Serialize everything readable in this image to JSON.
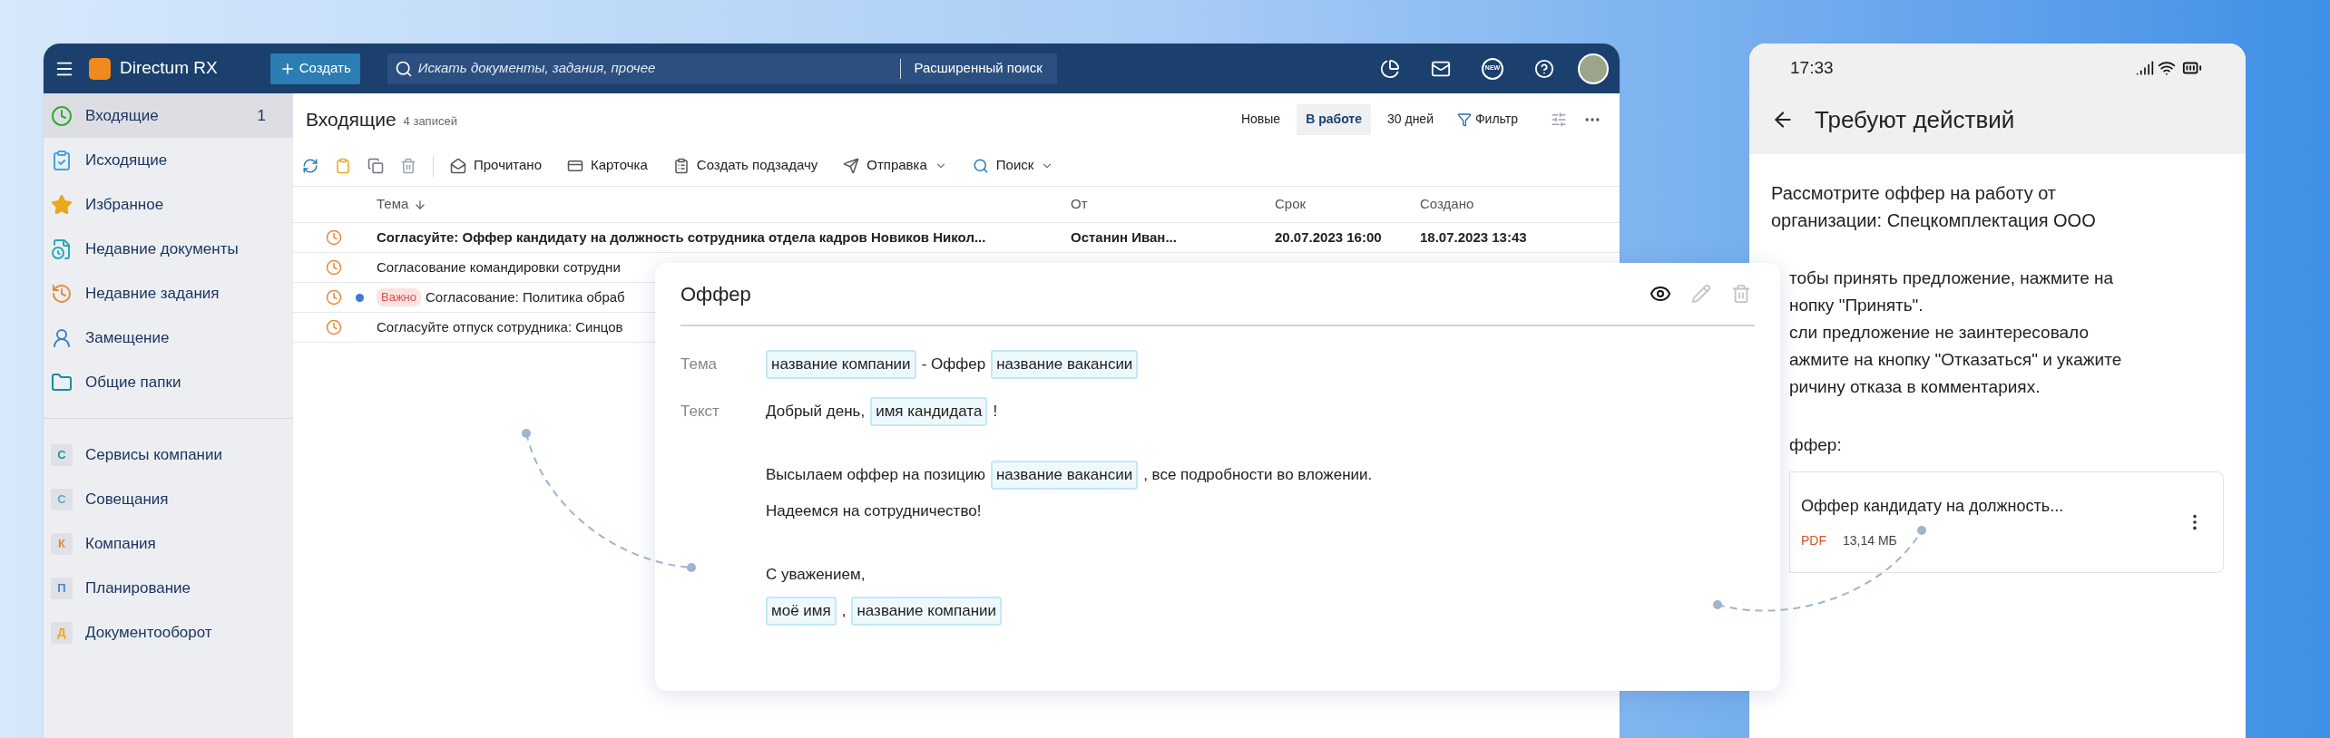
{
  "app": {
    "brand": "Directum RX",
    "create_button": "Создать",
    "search": {
      "placeholder": "Искать документы, задания, прочее"
    },
    "advanced_search": "Расширенный поиск",
    "new_badge": "NEW"
  },
  "sidebar": {
    "items": [
      {
        "kind": "folder",
        "label": "Входящие",
        "count": "1",
        "selected": true
      },
      {
        "kind": "folder",
        "label": "Исходящие",
        "selected": false
      },
      {
        "kind": "folder",
        "label": "Избранное",
        "selected": false
      },
      {
        "kind": "folder",
        "label": "Недавние документы",
        "selected": false
      },
      {
        "kind": "folder",
        "label": "Недавние задания",
        "selected": false
      },
      {
        "kind": "folder",
        "label": "Замещение",
        "selected": false
      },
      {
        "kind": "folder",
        "label": "Общие папки",
        "selected": false
      },
      {
        "kind": "module",
        "letter": "С",
        "color": "#1a9aa0",
        "label": "Сервисы компании",
        "selected": false
      },
      {
        "kind": "module",
        "letter": "С",
        "color": "#5aa9d6",
        "label": "Совещания",
        "selected": false
      },
      {
        "kind": "module",
        "letter": "К",
        "color": "#e08a3c",
        "label": "Компания",
        "selected": false
      },
      {
        "kind": "module",
        "letter": "П",
        "color": "#4a86c8",
        "label": "Планирование",
        "selected": false
      },
      {
        "kind": "module",
        "letter": "Д",
        "color": "#e5a823",
        "label": "Документооборот",
        "selected": false
      }
    ]
  },
  "list": {
    "title": "Входящие",
    "count": "4 записей",
    "filters": [
      {
        "label": "Новые",
        "selected": false
      },
      {
        "label": "В работе",
        "selected": true
      },
      {
        "label": "30 дней",
        "selected": false
      }
    ],
    "filter_button": "Фильтр",
    "toolbar": [
      {
        "label": "Прочитано",
        "dropdown": false
      },
      {
        "label": "Карточка",
        "dropdown": false
      },
      {
        "label": "Создать подзадачу",
        "dropdown": false
      },
      {
        "label": "Отправка",
        "dropdown": true
      },
      {
        "label": "Поиск",
        "dropdown": true
      }
    ],
    "columns": [
      "Тема",
      "От",
      "Срок",
      "Создано"
    ],
    "rows": [
      {
        "subject": "Согласуйте: Оффер кандидату на должность сотрудника отдела кадров Новиков Никол...",
        "from": "Останин Иван...",
        "due": "20.07.2023 16:00",
        "created": "18.07.2023 13:43",
        "unread": true,
        "flagged": false
      },
      {
        "subject": "Согласование командировки сотрудни",
        "unread": false,
        "flagged": false
      },
      {
        "subject": "Согласование: Политика обраб",
        "tag": "Важно",
        "unread": false,
        "flagged": true
      },
      {
        "subject": "Согласуйте отпуск сотрудника: Синцов",
        "unread": false,
        "flagged": false
      }
    ]
  },
  "template": {
    "title": "Оффер",
    "fields": [
      {
        "label": "Тема",
        "lines": [
          [
            {
              "kind": "token",
              "text": "название компании"
            },
            {
              "kind": "text",
              "text": "- Оффер"
            },
            {
              "kind": "token",
              "text": "название вакансии"
            }
          ]
        ]
      },
      {
        "label": "Текст",
        "lines": [
          [
            {
              "kind": "text",
              "text": "Добрый день,"
            },
            {
              "kind": "token",
              "text": "имя кандидата"
            },
            {
              "kind": "text",
              "text": "!"
            }
          ],
          [
            {
              "kind": "break"
            }
          ],
          [
            {
              "kind": "text",
              "text": "Высылаем оффер на позицию"
            },
            {
              "kind": "token",
              "text": "название вакансии"
            },
            {
              "kind": "text",
              "text": ", все подробности во вложении."
            }
          ],
          [
            {
              "kind": "text",
              "text": "Надеемся на сотрудничество!"
            }
          ],
          [
            {
              "kind": "break"
            }
          ],
          [
            {
              "kind": "text",
              "text": "С уважением,"
            }
          ],
          [
            {
              "kind": "token",
              "text": "моё имя"
            },
            {
              "kind": "text",
              "text": ","
            },
            {
              "kind": "token",
              "text": "название компании"
            }
          ]
        ]
      }
    ]
  },
  "phone": {
    "time": "17:33",
    "title": "Требуют действий",
    "intro": "Рассмотрите оффер на работу от организации: Спецкомплектация ООО",
    "instruction_lines": [
      "тобы принять предложение, нажмите на",
      "нопку \"Принять\".",
      "сли предложение не заинтересовало",
      "ажмите на кнопку \"Отказаться\" и укажите",
      "ричину отказа в комментариях."
    ],
    "section_label": "ффер:",
    "attachment": {
      "name": "Оффер кандидату на должность...",
      "type": "PDF",
      "size": "13,14 МБ"
    }
  }
}
